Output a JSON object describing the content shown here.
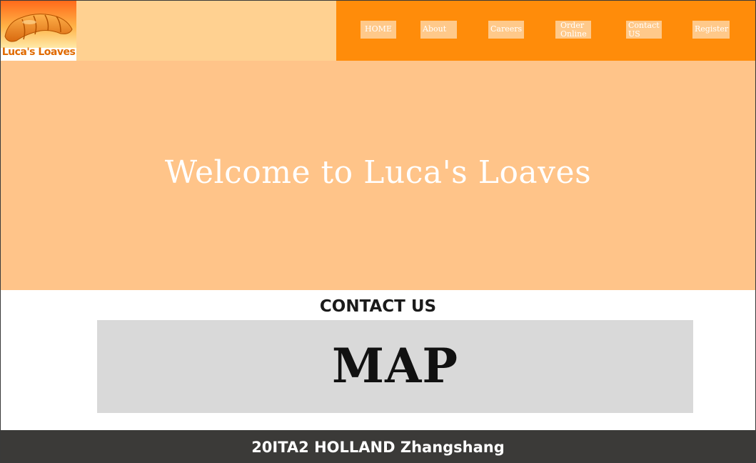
{
  "header": {
    "logo_text": "Luca's Loaves",
    "nav": [
      {
        "label": "HOME"
      },
      {
        "label": "About us"
      },
      {
        "label": "Careers"
      },
      {
        "label": "Order Online"
      },
      {
        "label": "Contact US"
      },
      {
        "label": "Register"
      }
    ]
  },
  "hero": {
    "title": "Welcome to Luca's Loaves"
  },
  "contact": {
    "heading": "CONTACT US",
    "map_label": "MAP"
  },
  "footer": {
    "text": "20ITA2 HOLLAND Zhangshang"
  },
  "colors": {
    "header_left": "#ffd191",
    "header_right": "#ff8c0a",
    "nav_button": "#ffc98a",
    "hero": "#ffc489",
    "map": "#d9d9d9",
    "footer": "#3b3a38"
  }
}
